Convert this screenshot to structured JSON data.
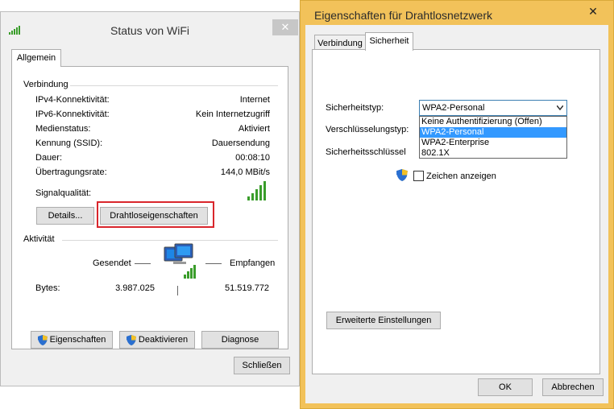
{
  "status_window": {
    "title": "Status von WiFi",
    "close_glyph": "✕",
    "tab": "Allgemein",
    "connection": {
      "group_label": "Verbindung",
      "rows": [
        {
          "label": "IPv4-Konnektivität:",
          "value": "Internet"
        },
        {
          "label": "IPv6-Konnektivität:",
          "value": "Kein Internetzugriff"
        },
        {
          "label": "Medienstatus:",
          "value": "Aktiviert"
        },
        {
          "label": "Kennung (SSID):",
          "value": "Dauersendung"
        },
        {
          "label": "Dauer:",
          "value": "00:08:10"
        },
        {
          "label": "Übertragungsrate:",
          "value": "144,0 MBit/s"
        }
      ],
      "signal_label": "Signalqualität:",
      "signal_bars": 5
    },
    "buttons": {
      "details": "Details...",
      "wireless_props": "Drahtloseigenschaften"
    },
    "activity": {
      "group_label": "Aktivität",
      "sent_label": "Gesendet",
      "received_label": "Empfangen",
      "bytes_label": "Bytes:",
      "bytes_sent": "3.987.025",
      "bytes_received": "51.519.772"
    },
    "bottom_buttons": {
      "properties": "Eigenschaften",
      "deactivate": "Deaktivieren",
      "diagnose": "Diagnose"
    },
    "close_button": "Schließen",
    "highlight_color": "#d9262c"
  },
  "prop_window": {
    "title": "Eigenschaften für Drahtlosnetzwerk",
    "close_glyph": "✕",
    "tabs": [
      {
        "label": "Verbindung",
        "active": false
      },
      {
        "label": "Sicherheit",
        "active": true
      }
    ],
    "security_type_label": "Sicherheitstyp:",
    "security_type_value": "WPA2-Personal",
    "encryption_label": "Verschlüsselungstyp:",
    "key_label": "Sicherheitsschlüssel",
    "dropdown_options": [
      {
        "label": "Keine Authentifizierung (Offen)",
        "selected": false
      },
      {
        "label": "WPA2-Personal",
        "selected": true
      },
      {
        "label": "WPA2-Enterprise",
        "selected": false
      },
      {
        "label": "802.1X",
        "selected": false
      }
    ],
    "show_chars_label": "Zeichen anzeigen",
    "show_chars_checked": false,
    "advanced_button": "Erweiterte Einstellungen",
    "ok_button": "OK",
    "cancel_button": "Abbrechen",
    "accent_color": "#f2c25a"
  }
}
